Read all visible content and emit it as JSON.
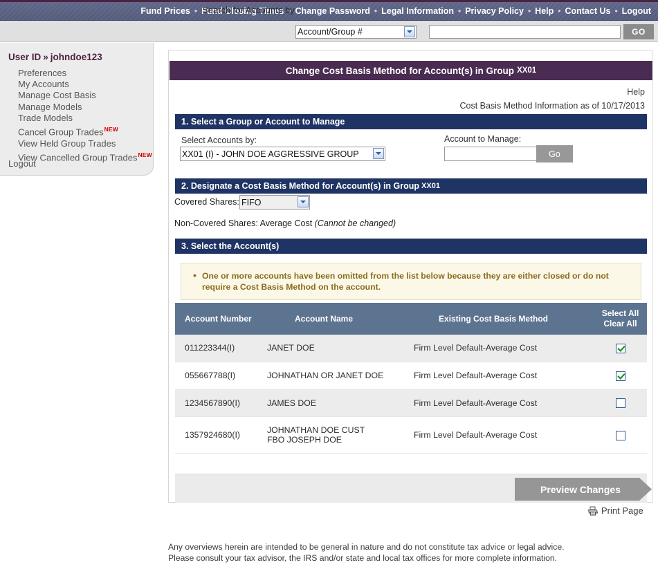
{
  "topnav": {
    "items": [
      {
        "label": "Fund Prices"
      },
      {
        "label": "Fund Closing Times"
      },
      {
        "label": "Change Password"
      },
      {
        "label": "Legal Information"
      },
      {
        "label": "Privacy Policy"
      },
      {
        "label": "Help"
      },
      {
        "label": "Contact Us"
      },
      {
        "label": "Logout"
      }
    ],
    "separator": "•",
    "bg_color": "#5f6687",
    "accent_color": "#4b2342"
  },
  "search": {
    "label": "Search for Accounts by",
    "select_value": "Account/Group #",
    "input_value": "",
    "input_placeholder": "",
    "go_label": "GO"
  },
  "sidebar": {
    "user_label": "User ID",
    "user_chevron": "»",
    "user_id": "johndoe123",
    "items": [
      {
        "label": "Preferences",
        "badge": ""
      },
      {
        "label": "My Accounts",
        "badge": ""
      },
      {
        "label": "Manage Cost Basis",
        "badge": ""
      },
      {
        "label": "Manage Models",
        "badge": ""
      },
      {
        "label": "Trade Models",
        "badge": ""
      },
      {
        "label": "Cancel Group Trades",
        "badge": "NEW"
      },
      {
        "label": "View Held Group Trades",
        "badge": ""
      },
      {
        "label": "View Cancelled Group Trades",
        "badge": "NEW"
      }
    ],
    "logout_label": "Logout"
  },
  "panel": {
    "title": "Change Cost Basis Method for Account(s) in Group",
    "title_group": "XX01",
    "help_label": "Help",
    "as_of": "Cost Basis Method Information as of 10/17/2013",
    "title_bg_color": "#4a2c52",
    "section_bg_color": "#1f3464"
  },
  "section1": {
    "heading": "1. Select a Group or Account to Manage",
    "select_accounts_label": "Select Accounts by:",
    "select_accounts_value": "XX01 (I) - JOHN DOE AGGRESSIVE GROUP",
    "account_to_manage_label": "Account to Manage:",
    "account_to_manage_value": "",
    "account_to_manage_placeholder": "",
    "go_label": "Go"
  },
  "section2": {
    "heading": "2. Designate a Cost Basis Method for Account(s) in Group",
    "heading_group": "XX01",
    "covered_shares_label": "Covered Shares:",
    "covered_shares_value": "FIFO",
    "non_covered_text": "Non-Covered Shares: Average Cost ",
    "non_covered_note": "(Cannot be changed)"
  },
  "section3": {
    "heading": "3. Select the Account(s)",
    "notice": "One or more accounts have been omitted from the list below because they are either closed or do not require a Cost Basis Method on the account.",
    "notice_color": "#8a6d1f",
    "columns": {
      "account_number": "Account Number",
      "account_name": "Account Name",
      "existing_method": "Existing Cost Basis Method",
      "select_all": "Select All",
      "clear_all": "Clear All"
    },
    "rows": [
      {
        "account_number": "011223344(I)",
        "account_name": "JANET DOE",
        "account_name_line2": "",
        "existing_method": "Firm Level Default-Average Cost",
        "checked": true
      },
      {
        "account_number": "055667788(I)",
        "account_name": "JOHNATHAN OR JANET DOE",
        "account_name_line2": "",
        "existing_method": "Firm Level Default-Average Cost",
        "checked": true
      },
      {
        "account_number": "1234567890(I)",
        "account_name": "JAMES DOE",
        "account_name_line2": "",
        "existing_method": "Firm Level Default-Average Cost",
        "checked": false
      },
      {
        "account_number": "1357924680(I)",
        "account_name": "JOHNATHAN DOE CUST",
        "account_name_line2": "FBO JOSEPH DOE",
        "existing_method": "Firm Level Default-Average Cost",
        "checked": false
      }
    ],
    "preview_label": "Preview Changes"
  },
  "footer": {
    "print_label": "Print Page",
    "disclaimer_line1": "Any overviews herein are intended to be general in nature and do not constitute tax advice or legal advice.",
    "disclaimer_line2": "Please consult your tax advisor, the IRS and/or state and local tax offices for more complete information."
  }
}
